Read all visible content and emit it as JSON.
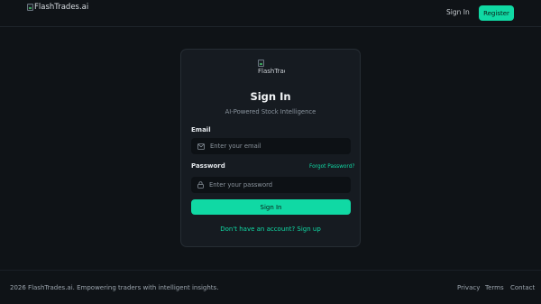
{
  "header": {
    "logo_alt": "FlashTrades.ai",
    "signin_label": "Sign In",
    "register_label": "Register"
  },
  "card": {
    "logo_alt": "FlashTrades.ai",
    "title": "Sign In",
    "subtitle": "AI-Powered Stock Intelligence",
    "email_label": "Email",
    "email_placeholder": "Enter your email",
    "password_label": "Password",
    "forgot_label": "Forgot Password?",
    "password_placeholder": "Enter your password",
    "submit_label": "Sign In",
    "signup_label": "Don't have an account? Sign up"
  },
  "footer": {
    "copyright": "2026 FlashTrades.ai. Empowering traders with intelligent insights.",
    "links": [
      "Privacy",
      "Terms",
      "Contact"
    ]
  },
  "colors": {
    "accent": "#10d9a4",
    "background": "#0f1317",
    "card": "#161b21"
  },
  "icons": {
    "email_field": "mail-icon",
    "password_field": "lock-icon",
    "logo": "broken-image-icon"
  }
}
